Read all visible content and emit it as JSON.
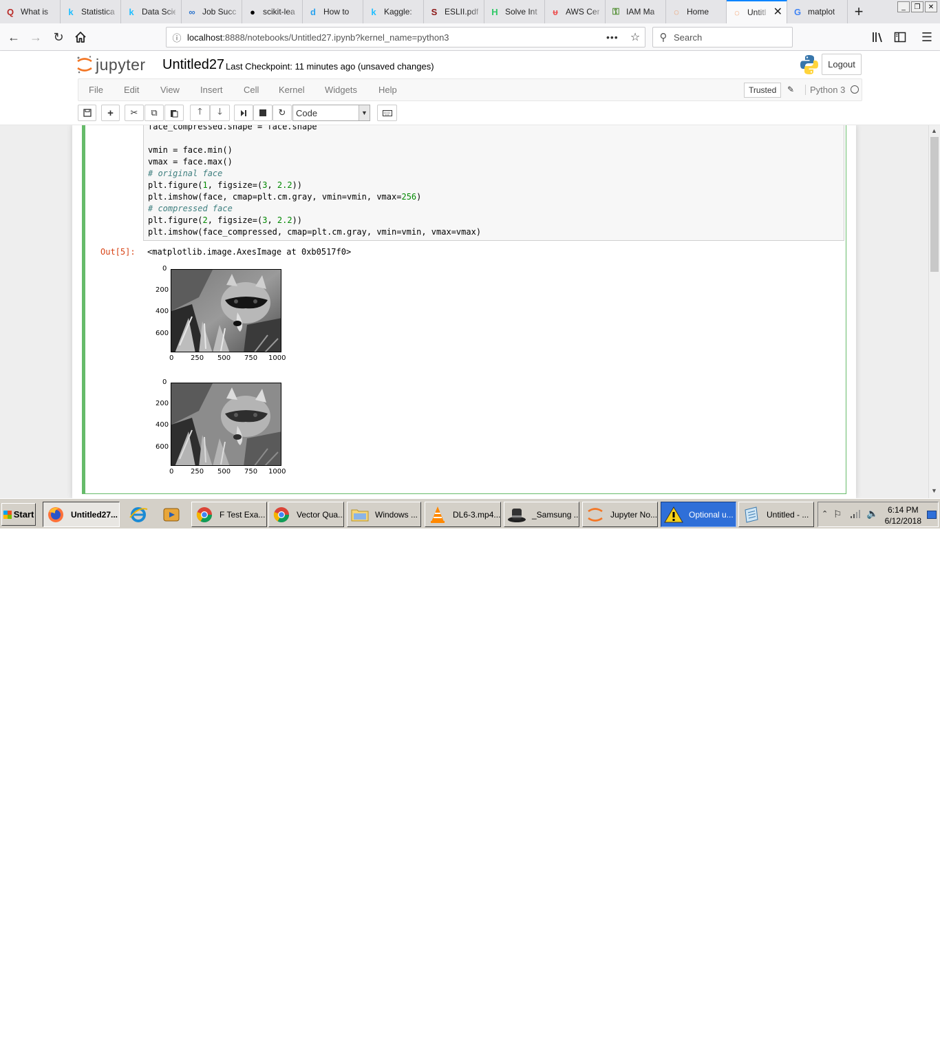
{
  "browser": {
    "tabs": [
      {
        "label": "What is",
        "icon": "quora-icon",
        "color": "#b92b27"
      },
      {
        "label": "Statistica",
        "icon": "kaggle-icon",
        "color": "#20beff"
      },
      {
        "label": "Data Scie",
        "icon": "kaggle-icon",
        "color": "#20beff"
      },
      {
        "label": "Job Succ",
        "icon": "coursera-icon",
        "color": "#2a73cc"
      },
      {
        "label": "scikit-lea",
        "icon": "github-icon",
        "color": "#000000"
      },
      {
        "label": "How to",
        "icon": "d-icon",
        "color": "#2aa3ef"
      },
      {
        "label": "Kaggle:",
        "icon": "kaggle-icon",
        "color": "#20beff"
      },
      {
        "label": "ESLII.pdf",
        "icon": "stanford-icon",
        "color": "#8c1515"
      },
      {
        "label": "Solve Int",
        "icon": "hackerrank-icon",
        "color": "#2ec866"
      },
      {
        "label": "AWS Cer",
        "icon": "udemy-icon",
        "color": "#ec5252"
      },
      {
        "label": "IAM Ma",
        "icon": "key-icon",
        "color": "#4a8a2a"
      },
      {
        "label": "Home",
        "icon": "jupyter-icon",
        "color": "#f37726"
      },
      {
        "label": "Untitl",
        "icon": "jupyter-icon",
        "color": "#f37726",
        "active": true
      },
      {
        "label": "matplot",
        "icon": "google-icon",
        "color": "#4285f4"
      }
    ],
    "url_host": "localhost",
    "url_rest": ":8888/notebooks/Untitled27.ipynb?kernel_name=python3",
    "search_placeholder": "Search"
  },
  "jupyter": {
    "logo_text": "jupyter",
    "notebook_title": "Untitled27",
    "checkpoint": "Last Checkpoint: 11 minutes ago (unsaved changes)",
    "logout_label": "Logout",
    "menu": [
      "File",
      "Edit",
      "View",
      "Insert",
      "Cell",
      "Kernel",
      "Widgets",
      "Help"
    ],
    "trusted_label": "Trusted",
    "kernel_name": "Python 3",
    "cell_type": "Code"
  },
  "cell": {
    "out_prompt": "Out[5]:",
    "out_text": "<matplotlib.image.AxesImage at 0xb0517f0>"
  },
  "plots": [
    {
      "y_ticks": [
        "0",
        "200",
        "400",
        "600"
      ],
      "x_ticks": [
        "0",
        "250",
        "500",
        "750",
        "1000"
      ]
    },
    {
      "y_ticks": [
        "0",
        "200",
        "400",
        "600"
      ],
      "x_ticks": [
        "0",
        "250",
        "500",
        "750",
        "1000"
      ]
    }
  ],
  "taskbar": {
    "start_label": "Start",
    "items": [
      {
        "label": "Untitled27...",
        "icon": "firefox-icon",
        "state": "pressed"
      },
      {
        "label": "F Test Exa...",
        "icon": "chrome-icon"
      },
      {
        "label": "Vector Qua...",
        "icon": "chrome-icon"
      },
      {
        "label": "Windows ...",
        "icon": "folder-icon"
      },
      {
        "label": "DL6-3.mp4...",
        "icon": "vlc-icon"
      },
      {
        "label": "_Samsung ...",
        "icon": "hat-icon"
      },
      {
        "label": "Jupyter No...",
        "icon": "jupyter-icon"
      },
      {
        "label": "Optional u...",
        "icon": "warning-icon",
        "state": "alert"
      },
      {
        "label": "Untitled - ...",
        "icon": "notepad-icon"
      }
    ],
    "clock_time": "6:14 PM",
    "clock_date": "6/12/2018"
  }
}
